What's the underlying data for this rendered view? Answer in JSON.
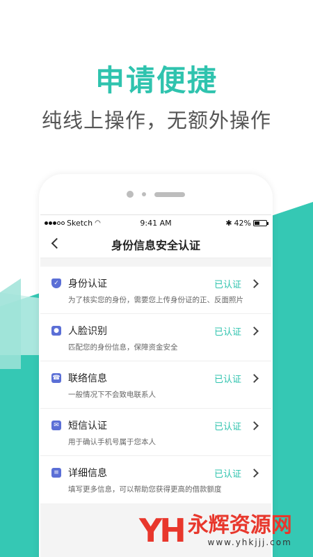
{
  "headline": "申请便捷",
  "subheadline": "纯线上操作，无额外操作",
  "statusbar": {
    "carrier": "Sketch",
    "time": "9:41 AM",
    "battery": "42%"
  },
  "navbar": {
    "title": "身份信息安全认证"
  },
  "items": [
    {
      "title": "身份认证",
      "status": "已认证",
      "desc": "为了核实您的身份，需要您上传身份证的正、反面照片",
      "icon": "shield-icon"
    },
    {
      "title": "人脸识别",
      "status": "已认证",
      "desc": "匹配您的身份信息，保障资金安全",
      "icon": "face-icon"
    },
    {
      "title": "联络信息",
      "status": "已认证",
      "desc": "一般情况下不会致电联系人",
      "icon": "phone-icon"
    },
    {
      "title": "短信认证",
      "status": "已认证",
      "desc": "用于确认手机号属于您本人",
      "icon": "mail-icon"
    },
    {
      "title": "详细信息",
      "status": "已认证",
      "desc": "填写更多信息，可以帮助您获得更高的借款额度",
      "icon": "document-icon"
    }
  ],
  "watermark": {
    "logo": "YH",
    "name": "永辉资源网",
    "url": "www.yhkjjj.com"
  },
  "colors": {
    "accent": "#2fc3ae",
    "icon": "#5b6fd6",
    "watermark": "#e8372c"
  }
}
